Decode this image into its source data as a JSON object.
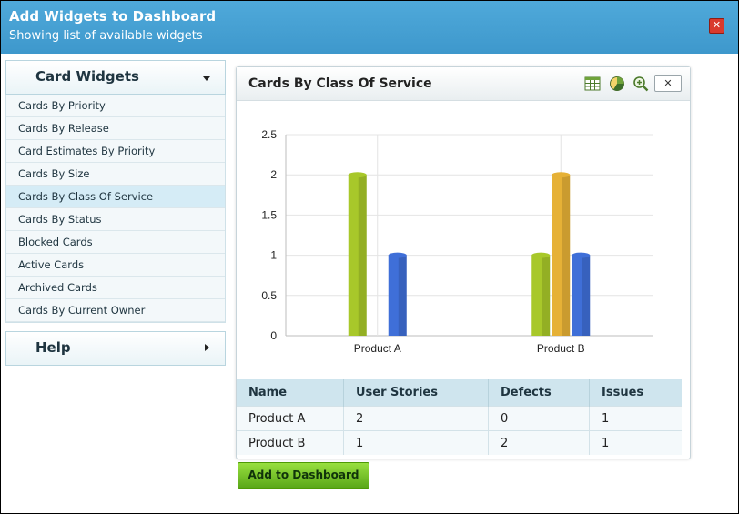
{
  "dialog": {
    "title": "Add Widgets to Dashboard",
    "subtitle": "Showing list of available widgets",
    "close_icon": "close-icon"
  },
  "sidebar": {
    "card_widgets_label": "Card Widgets",
    "items": [
      {
        "label": "Cards By Priority"
      },
      {
        "label": "Cards By Release"
      },
      {
        "label": "Card Estimates By Priority"
      },
      {
        "label": "Cards By Size"
      },
      {
        "label": "Cards By Class Of Service",
        "selected": true
      },
      {
        "label": "Cards By Status"
      },
      {
        "label": "Blocked Cards"
      },
      {
        "label": "Active Cards"
      },
      {
        "label": "Archived Cards"
      },
      {
        "label": "Cards By Current Owner"
      }
    ],
    "help_label": "Help"
  },
  "panel": {
    "title": "Cards By Class Of Service",
    "tools": [
      "table-view-icon",
      "pie-chart-icon",
      "zoom-in-icon",
      "close-icon"
    ],
    "close_label": "✕"
  },
  "chart_data": {
    "type": "bar",
    "categories": [
      "Product A",
      "Product B"
    ],
    "series": [
      {
        "values": [
          2,
          1
        ],
        "color": "#a8c82a"
      },
      {
        "values": [
          0,
          2
        ],
        "color": "#e6b136"
      },
      {
        "values": [
          1,
          1
        ],
        "color": "#3f6fd8"
      }
    ],
    "yticks": [
      "0",
      "0.5",
      "1",
      "1.5",
      "2",
      "2.5"
    ],
    "ylim": [
      0,
      2.5
    ],
    "grid": true
  },
  "table": {
    "headers": [
      "Name",
      "User Stories",
      "Defects",
      "Issues"
    ],
    "rows": [
      [
        "Product A",
        "2",
        "0",
        "1"
      ],
      [
        "Product B",
        "1",
        "2",
        "1"
      ]
    ]
  },
  "footer": {
    "add_label": "Add to Dashboard"
  },
  "colors": {
    "header": "#3e98cc",
    "selected_row": "#d5ecf6",
    "add_button": "#5aa819"
  }
}
